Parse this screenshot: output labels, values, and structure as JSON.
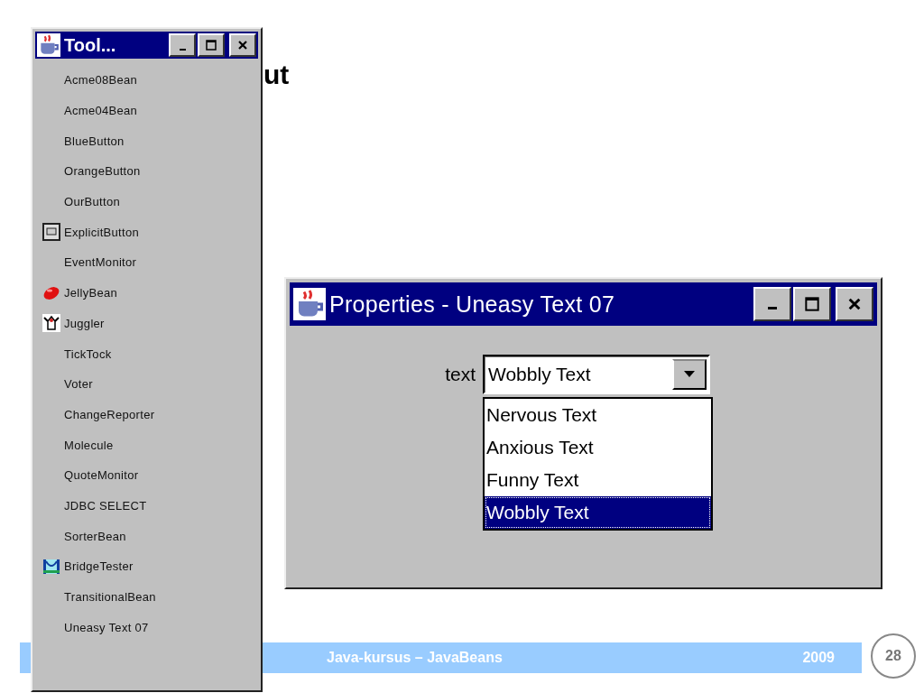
{
  "slide": {
    "title": "ut",
    "footer": {
      "course": "Java-kursus – JavaBeans",
      "year": "2009",
      "page": "28"
    }
  },
  "toolbox": {
    "title": "Tool...",
    "items": [
      {
        "label": "Acme08Bean",
        "kind": "plain"
      },
      {
        "label": "Acme04Bean",
        "kind": "plain"
      },
      {
        "label": "BlueButton",
        "kind": "plain"
      },
      {
        "label": "OrangeButton",
        "kind": "plain"
      },
      {
        "label": "OurButton",
        "kind": "plain"
      },
      {
        "label": "ExplicitButton",
        "kind": "frame"
      },
      {
        "label": "EventMonitor",
        "kind": "plain"
      },
      {
        "label": "JellyBean",
        "kind": "bean"
      },
      {
        "label": "Juggler",
        "kind": "figure"
      },
      {
        "label": "TickTock",
        "kind": "plain"
      },
      {
        "label": "Voter",
        "kind": "plain"
      },
      {
        "label": "ChangeReporter",
        "kind": "plain"
      },
      {
        "label": "Molecule",
        "kind": "plain"
      },
      {
        "label": "QuoteMonitor",
        "kind": "plain"
      },
      {
        "label": "JDBC SELECT",
        "kind": "plain"
      },
      {
        "label": "SorterBean",
        "kind": "plain"
      },
      {
        "label": "BridgeTester",
        "kind": "bridge"
      },
      {
        "label": "TransitionalBean",
        "kind": "plain"
      },
      {
        "label": "Uneasy Text 07",
        "kind": "plain"
      }
    ]
  },
  "properties": {
    "title": "Properties - Uneasy Text 07",
    "field": {
      "label": "text",
      "value": "Wobbly Text",
      "expanded": true,
      "options": [
        {
          "label": "Nervous Text",
          "selected": false
        },
        {
          "label": "Anxious Text",
          "selected": false
        },
        {
          "label": "Funny Text",
          "selected": false
        },
        {
          "label": "Wobbly Text",
          "selected": true
        }
      ]
    }
  }
}
